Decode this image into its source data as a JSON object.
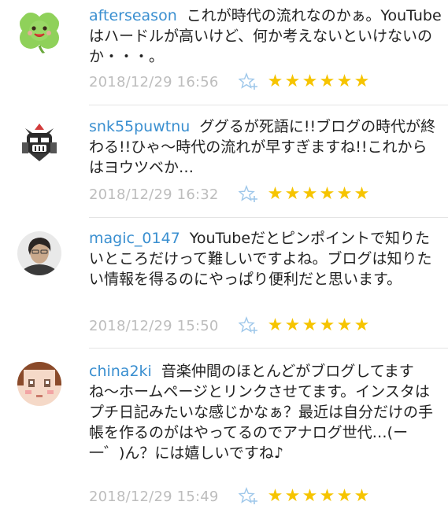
{
  "comments": [
    {
      "username": "afterseason",
      "text": "これが時代の流れなのかぁ。YouTubeはハードルが高いけど、何か考えないといけないのか・・・。",
      "timestamp": "2018/12/29 16:56",
      "stars": [
        "★",
        "★",
        "★",
        "★",
        "★",
        "★"
      ],
      "avatar_icon": "clover-face-icon"
    },
    {
      "username": "snk55puwtnu",
      "text": "ググるが死語に!!ブログの時代が終わる!!ひゃ〜時代の流れが早すぎますね!!これからはヨウツベか…",
      "timestamp": "2018/12/29 16:32",
      "stars": [
        "★",
        "★",
        "★",
        "★",
        "★",
        "★"
      ],
      "avatar_icon": "robot-helmet-icon"
    },
    {
      "username": "magic_0147",
      "text": "YouTubeだとピンポイントで知りたいところだけって難しいですよね。ブログは知りたい情報を得るのにやっぱり便利だと思います。",
      "timestamp": "2018/12/29 15:50",
      "stars": [
        "★",
        "★",
        "★",
        "★",
        "★",
        "★"
      ],
      "avatar_icon": "person-photo-icon"
    },
    {
      "username": "china2ki",
      "text": "音楽仲間のほとんどがブログしてますね〜ホームページとリンクさせてます。インスタはプチ日記みたいな感じかなぁ？最近は自分だけの手帳を作るのがはやってるのでアナログ世代…(ー一゛)ん？には嬉しいですね♪",
      "timestamp": "2018/12/29 15:49",
      "stars": [
        "★",
        "★",
        "★",
        "★",
        "★",
        "★"
      ],
      "avatar_icon": "pixel-face-icon"
    }
  ],
  "colors": {
    "username": "#3a8fd0",
    "timestamp": "#bdbdbd",
    "star": "#f6c400",
    "divider": "#e4e4e4"
  }
}
